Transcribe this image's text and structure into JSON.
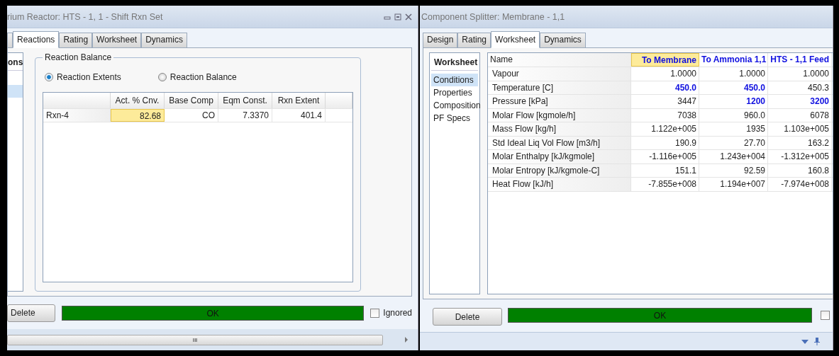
{
  "left_window": {
    "title": "rium Reactor: HTS - 1, 1 - Shift Rxn Set",
    "tabs": [
      {
        "label": "Reactions",
        "selected": true
      },
      {
        "label": "Rating",
        "selected": false
      },
      {
        "label": "Worksheet",
        "selected": false
      },
      {
        "label": "Dynamics",
        "selected": false
      }
    ],
    "sidebar": {
      "heading": "ons",
      "items": [
        {
          "selected": true
        }
      ]
    },
    "group": {
      "title": "Reaction Balance",
      "options": [
        {
          "label": "Reaction Extents",
          "selected": true
        },
        {
          "label": "Reaction Balance",
          "selected": false
        }
      ],
      "table": {
        "columns": [
          "Act. % Cnv.",
          "Base Comp",
          "Eqm Const.",
          "Rxn Extent"
        ],
        "rows": [
          {
            "name": "Rxn-4",
            "cells": [
              {
                "value": "82.68",
                "selected": true
              },
              {
                "value": "CO",
                "selected": false
              },
              {
                "value": "7.3370",
                "selected": false
              },
              {
                "value": "401.4",
                "selected": false
              }
            ]
          }
        ]
      }
    },
    "footer": {
      "delete": "Delete",
      "status": "OK",
      "ignored": {
        "label": "Ignored",
        "checked": false
      }
    },
    "scrollbar_grip": "III"
  },
  "right_window": {
    "title": "Component Splitter: Membrane - 1,1",
    "tabs": [
      {
        "label": "Design",
        "selected": false
      },
      {
        "label": "Rating",
        "selected": false
      },
      {
        "label": "Worksheet",
        "selected": true
      },
      {
        "label": "Dynamics",
        "selected": false
      }
    ],
    "sidebar": {
      "heading": "Worksheet",
      "items": [
        {
          "label": "Conditions",
          "selected": true
        },
        {
          "label": "Properties",
          "selected": false
        },
        {
          "label": "Composition",
          "selected": false
        },
        {
          "label": "PF Specs",
          "selected": false
        }
      ]
    },
    "grid": {
      "name_header": "Name",
      "columns": [
        {
          "label": "To Membrane",
          "selected": true
        },
        {
          "label": "To Ammonia 1,1",
          "selected": false
        },
        {
          "label": "HTS - 1,1 Feed",
          "selected": false
        }
      ],
      "rows": [
        {
          "name": "Vapour",
          "cells": [
            {
              "value": "1.0000",
              "specified": false
            },
            {
              "value": "1.0000",
              "specified": false
            },
            {
              "value": "1.0000",
              "specified": false
            }
          ]
        },
        {
          "name": "Temperature [C]",
          "cells": [
            {
              "value": "450.0",
              "specified": true
            },
            {
              "value": "450.0",
              "specified": true
            },
            {
              "value": "450.3",
              "specified": false
            }
          ]
        },
        {
          "name": "Pressure [kPa]",
          "cells": [
            {
              "value": "3447",
              "specified": false
            },
            {
              "value": "1200",
              "specified": true
            },
            {
              "value": "3200",
              "specified": true
            }
          ]
        },
        {
          "name": "Molar Flow [kgmole/h]",
          "cells": [
            {
              "value": "7038",
              "specified": false
            },
            {
              "value": "960.0",
              "specified": false
            },
            {
              "value": "6078",
              "specified": false
            }
          ]
        },
        {
          "name": "Mass Flow [kg/h]",
          "cells": [
            {
              "value": "1.122e+005",
              "specified": false
            },
            {
              "value": "1935",
              "specified": false
            },
            {
              "value": "1.103e+005",
              "specified": false
            }
          ]
        },
        {
          "name": "Std Ideal Liq Vol Flow [m3/h]",
          "cells": [
            {
              "value": "190.9",
              "specified": false
            },
            {
              "value": "27.70",
              "specified": false
            },
            {
              "value": "163.2",
              "specified": false
            }
          ]
        },
        {
          "name": "Molar Enthalpy [kJ/kgmole]",
          "cells": [
            {
              "value": "-1.116e+005",
              "specified": false
            },
            {
              "value": "1.243e+004",
              "specified": false
            },
            {
              "value": "-1.312e+005",
              "specified": false
            }
          ]
        },
        {
          "name": "Molar Entropy [kJ/kgmole-C]",
          "cells": [
            {
              "value": "151.1",
              "specified": false
            },
            {
              "value": "92.59",
              "specified": false
            },
            {
              "value": "160.8",
              "specified": false
            }
          ]
        },
        {
          "name": "Heat Flow [kJ/h]",
          "cells": [
            {
              "value": "-7.855e+008",
              "specified": false
            },
            {
              "value": "1.194e+007",
              "specified": false
            },
            {
              "value": "-7.974e+008",
              "specified": false
            }
          ]
        }
      ]
    },
    "footer": {
      "delete": "Delete",
      "status": "OK",
      "ignored": {
        "checked": false
      }
    }
  }
}
